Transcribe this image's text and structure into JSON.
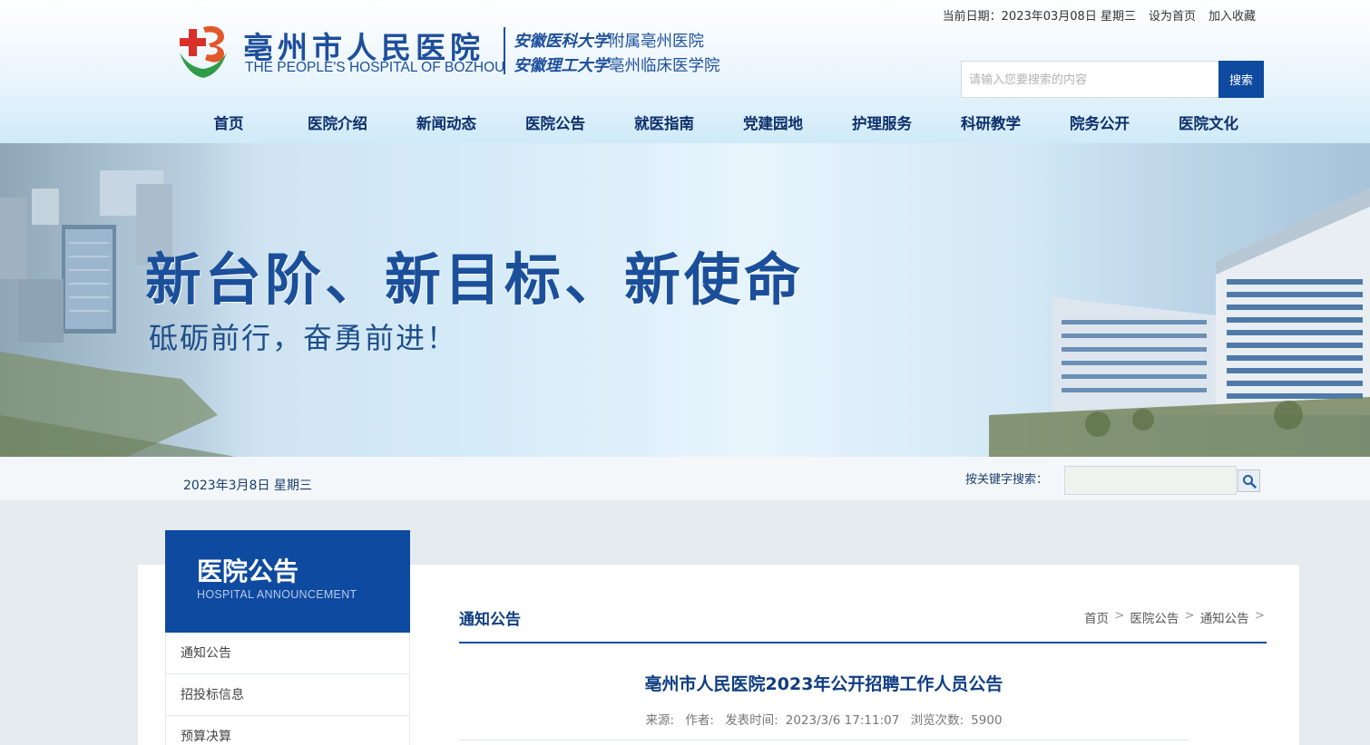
{
  "topbar": {
    "date_label": "当前日期：",
    "date_value": "2023年03月08日 星期三",
    "set_home": "设为首页",
    "add_favorite": "加入收藏"
  },
  "logo": {
    "name_cn": "亳州市人民医院",
    "name_en": "THE PEOPLE'S HOSPITAL OF BOZHOU",
    "affiliation1_univ": "安徽医科大学",
    "affiliation1_rest": "附属亳州医院",
    "affiliation2_univ": "安徽理工大学",
    "affiliation2_rest": "亳州临床医学院"
  },
  "search": {
    "placeholder": "请输入您要搜索的内容",
    "button_label": "搜索"
  },
  "nav": {
    "items": [
      {
        "label": "首页"
      },
      {
        "label": "医院介绍"
      },
      {
        "label": "新闻动态"
      },
      {
        "label": "医院公告"
      },
      {
        "label": "就医指南"
      },
      {
        "label": "党建园地"
      },
      {
        "label": "护理服务"
      },
      {
        "label": "科研教学"
      },
      {
        "label": "院务公开"
      },
      {
        "label": "医院文化"
      }
    ]
  },
  "banner": {
    "title": "新台阶、新目标、新使命",
    "subtitle": "砥砺前行，奋勇前进！"
  },
  "datebar": {
    "date": "2023年3月8日 星期三",
    "keyword_label": "按关键字搜索："
  },
  "sidebar": {
    "title_cn": "医院公告",
    "title_en": "HOSPITAL ANNOUNCEMENT",
    "items": [
      {
        "label": "通知公告"
      },
      {
        "label": "招投标信息"
      },
      {
        "label": "预算决算"
      }
    ]
  },
  "main": {
    "section_title": "通知公告",
    "breadcrumb": [
      "首页",
      "医院公告",
      "通知公告"
    ],
    "article": {
      "title": "亳州市人民医院2023年公开招聘工作人员公告",
      "source_label": "来源:",
      "author_label": "作者:",
      "publish_label": "发表时间:",
      "publish_time": "2023/3/6 17:11:07",
      "views_label": "浏览次数:",
      "views": "5900"
    }
  },
  "colors": {
    "brand_blue": "#0e4aa0",
    "nav_text": "#0d2f6b",
    "logo_red": "#d9312a",
    "logo_green": "#2e9b48"
  }
}
